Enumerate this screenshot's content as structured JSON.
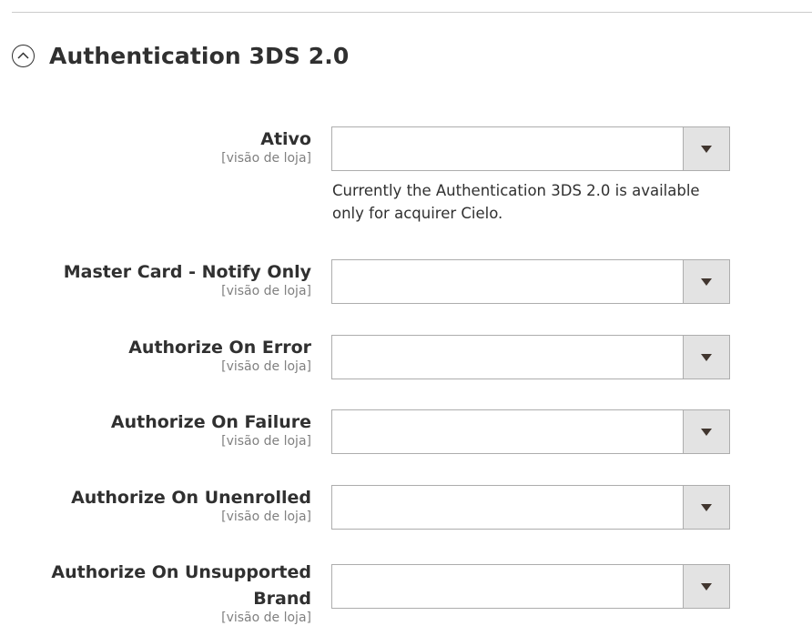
{
  "section": {
    "title": "Authentication 3DS 2.0",
    "icon": "chevron-up-circle-icon"
  },
  "fields": [
    {
      "label": "Ativo",
      "scope": "[visão de loja]",
      "value": "",
      "note": "Currently the Authentication 3DS 2.0 is available only for acquirer Cielo."
    },
    {
      "label": "Master Card - Notify Only",
      "scope": "[visão de loja]",
      "value": ""
    },
    {
      "label": "Authorize On Error",
      "scope": "[visão de loja]",
      "value": ""
    },
    {
      "label": "Authorize On Failure",
      "scope": "[visão de loja]",
      "value": ""
    },
    {
      "label": "Authorize On Unenrolled",
      "scope": "[visão de loja]",
      "value": ""
    },
    {
      "label": "Authorize On Unsupported Brand",
      "scope": "[visão de loja]",
      "value": ""
    }
  ],
  "colors": {
    "text": "#303030",
    "scope_text": "#808080",
    "select_border": "#adadad",
    "select_arrow_bg": "#e3e3e3"
  }
}
